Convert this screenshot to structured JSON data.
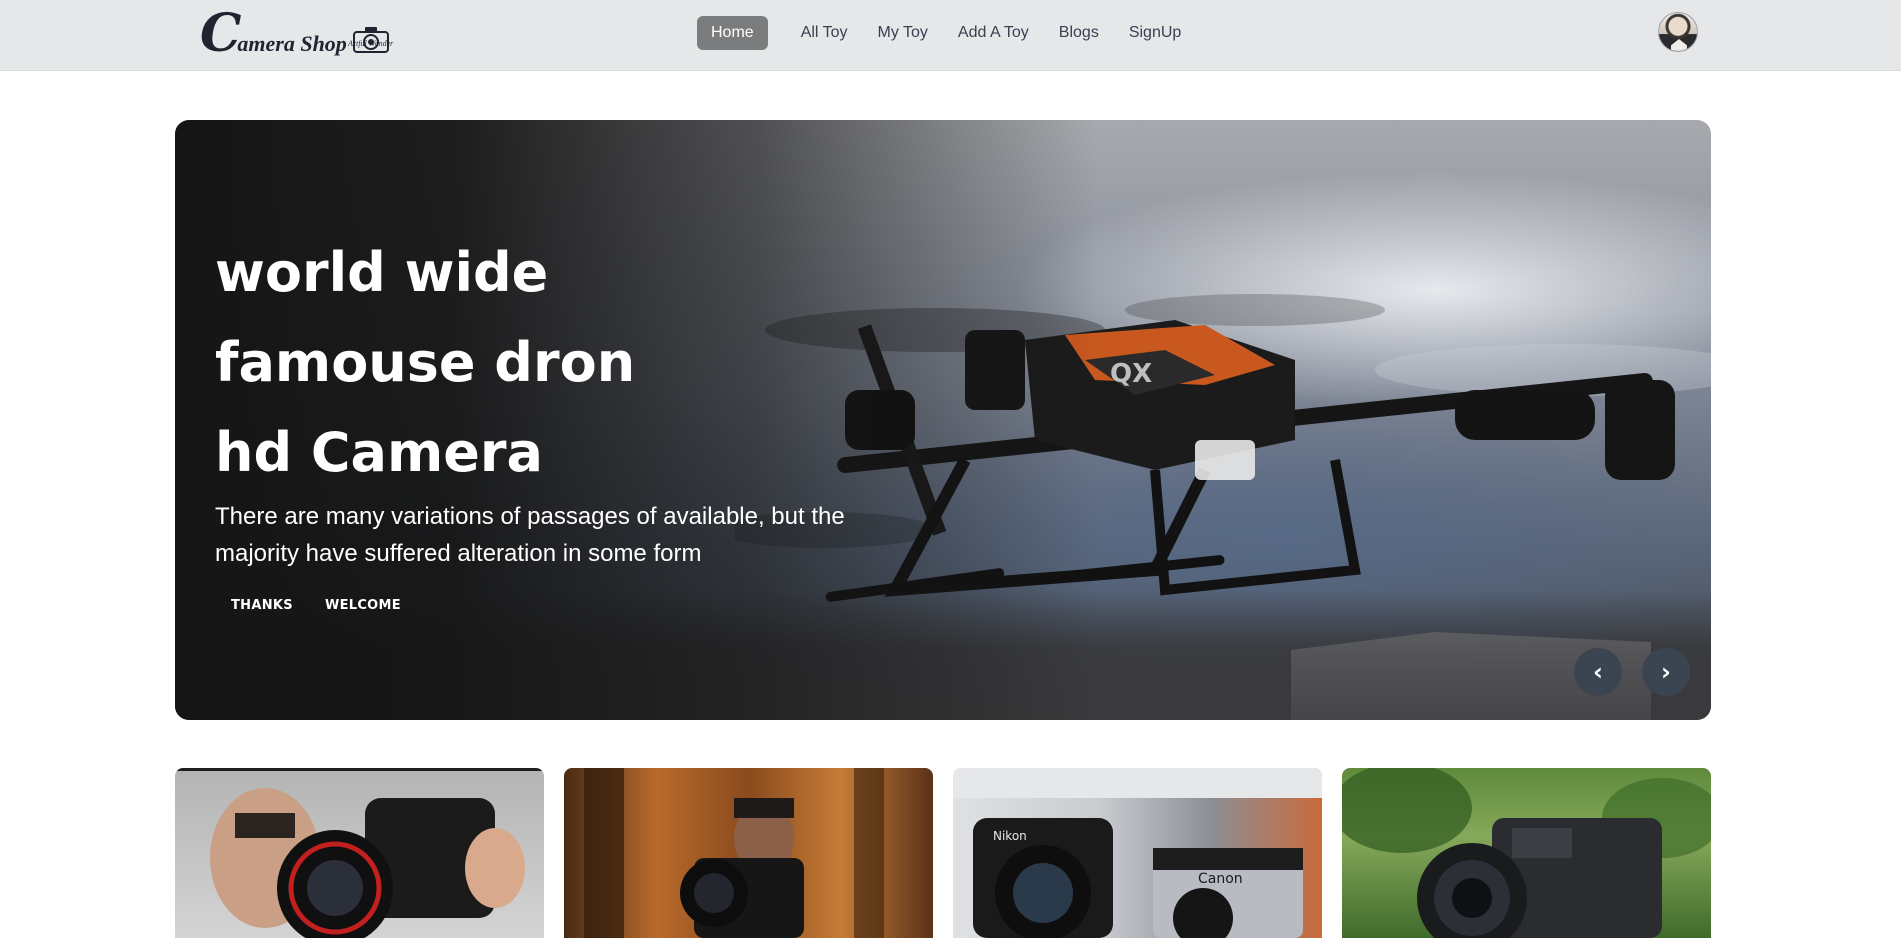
{
  "brand": {
    "name_initial": "C",
    "name_rest": "amera Shop",
    "tagline": "Artful Wonder"
  },
  "nav": {
    "items": [
      {
        "label": "Home",
        "active": true
      },
      {
        "label": "All Toy"
      },
      {
        "label": "My Toy"
      },
      {
        "label": "Add A Toy"
      },
      {
        "label": "Blogs"
      },
      {
        "label": "SignUp"
      }
    ]
  },
  "user": {
    "avatar_icon": "user-avatar"
  },
  "hero": {
    "title_lines": [
      "world wide",
      "famouse dron",
      "hd Camera"
    ],
    "description": "There are many variations of passages of available, but the majority have suffered alteration in some form",
    "buttons": [
      "THANKS",
      "WELCOME"
    ],
    "prev_arrow": "‹",
    "next_arrow": "›"
  },
  "colors": {
    "navbar_bg": "#e5e7e8",
    "active_nav_bg": "#7b7c7d",
    "arrow_bg": "#3b4451"
  },
  "cards": [
    {
      "icon": "camera-photo"
    },
    {
      "icon": "camera-photo"
    },
    {
      "icon": "camera-photo"
    },
    {
      "icon": "camera-photo"
    }
  ]
}
